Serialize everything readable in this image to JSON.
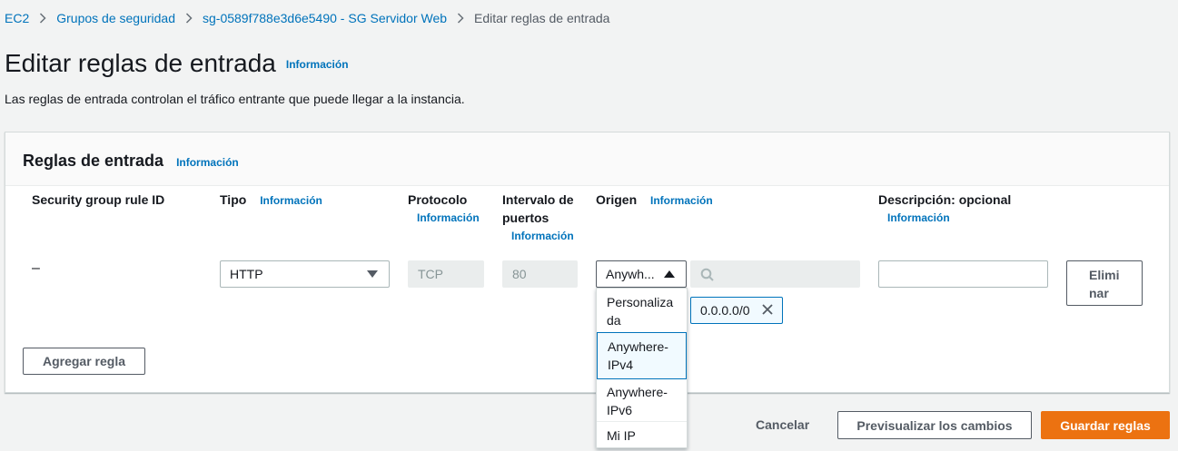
{
  "breadcrumb": {
    "items": [
      "EC2",
      "Grupos de seguridad",
      "sg-0589f788e3d6e5490 - SG Servidor Web"
    ],
    "current": "Editar reglas de entrada"
  },
  "page": {
    "title": "Editar reglas de entrada",
    "info": "Información",
    "description": "Las reglas de entrada controlan el tráfico entrante que puede llegar a la instancia."
  },
  "panel": {
    "title": "Reglas de entrada",
    "info": "Información",
    "columns": {
      "rule_id": "Security group rule ID",
      "type": "Tipo",
      "type_info": "Información",
      "protocol": "Protocolo",
      "protocol_info": "Información",
      "port_range_line1": "Intervalo de",
      "port_range_line2": "puertos",
      "port_range_info": "Información",
      "origin": "Origen",
      "origin_info": "Información",
      "description": "Descripción: opcional",
      "description_info": "Información"
    },
    "rule": {
      "rule_id": "–",
      "type": "HTTP",
      "protocol": "TCP",
      "port_range": "80",
      "origin": "Anywh...",
      "cidr_token": "0.0.0.0/0",
      "description_value": "",
      "delete_line1": "Elimi",
      "delete_line2": "nar"
    },
    "origin_options": [
      {
        "line1": "Personaliza",
        "line2": "da"
      },
      {
        "line1": "Anywhere-",
        "line2": "IPv4"
      },
      {
        "line1": "Anywhere-",
        "line2": "IPv6"
      },
      {
        "line1": "Mi IP",
        "line2": ""
      }
    ],
    "origin_selected_option": "Anywhere-IPv4",
    "add_rule": "Agregar regla"
  },
  "footer": {
    "cancel": "Cancelar",
    "preview": "Previsualizar los cambios",
    "save": "Guardar reglas"
  },
  "colors": {
    "link": "#0073bb",
    "primary": "#ec7211",
    "background": "#f2f3f3"
  },
  "icons": [
    "chevron-right-icon",
    "caret-down-icon",
    "caret-up-icon",
    "search-icon",
    "close-icon"
  ]
}
